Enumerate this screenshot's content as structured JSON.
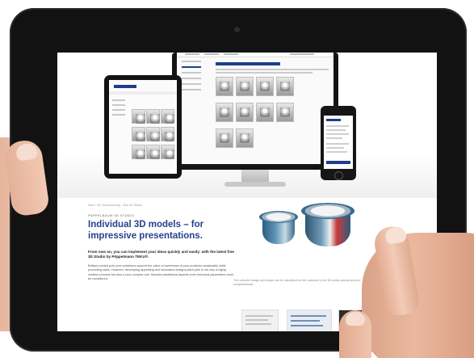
{
  "page": {
    "breadcrumb": "Start › 3D Visualisierung › Bild 3D Studio",
    "eyebrow": "PAPPELBAUM 3D STUDIO",
    "headline": "Individual 3D models – for impressive presentations.",
    "lead": "From now on, you can implement your ideas quickly and easily: with the latest free 3D Studio by Pöppelmann TEKU®.",
    "body": "Brilliant printed pots and containers support the value of sweetness of your products sustainably while promoting sales. However, developing appealing and innovative designs plant pots is not only a highly creative process but also a very complex one. Besides aesthetical aspects even technical parameters must be considered.",
    "caption": "The colourful design and shape can be visualised for the customer in the 3D studio quickly and in a comprehensive."
  },
  "monitor": {
    "title": "Kunst Packaging Design Service"
  },
  "colors": {
    "brand_blue": "#26418f",
    "tablet_frame": "#121212"
  }
}
